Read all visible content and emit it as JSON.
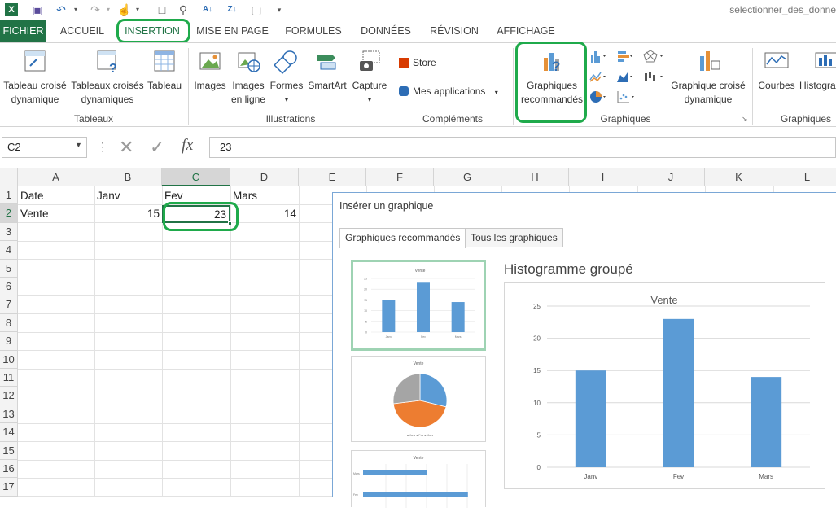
{
  "window": {
    "file_name": "selectionner_des_donne"
  },
  "tabs": [
    "FICHIER",
    "ACCUEIL",
    "INSERTION",
    "MISE EN PAGE",
    "FORMULES",
    "DONNÉES",
    "RÉVISION",
    "AFFICHAGE"
  ],
  "ribbon": {
    "tableaux": {
      "group": "Tableaux",
      "btn1": "Tableau croisé\ndynamique",
      "btn2": "Tableaux croisés\ndynamiques",
      "btn3": "Tableau"
    },
    "illustrations": {
      "group": "Illustrations",
      "images": "Images",
      "images_line": "Images\nen ligne",
      "formes": "Formes",
      "smartart": "SmartArt",
      "capture": "Capture"
    },
    "complements": {
      "group": "Compléments",
      "store": "Store",
      "apps": "Mes applications"
    },
    "graphiques": {
      "group": "Graphiques",
      "recommended": "Graphiques\nrecommandés",
      "pivot_chart": "Graphique croisé\ndynamique"
    },
    "sparklines": {
      "group": "Graphiques",
      "courbes": "Courbes",
      "histog": "Histogra"
    }
  },
  "formula_bar": {
    "name_box": "C2",
    "value": "23"
  },
  "sheet": {
    "columns": [
      "A",
      "B",
      "C",
      "D",
      "E",
      "F",
      "G",
      "H",
      "I",
      "J",
      "K",
      "L"
    ],
    "rows": [
      "1",
      "2",
      "3",
      "4",
      "5",
      "6",
      "7",
      "8",
      "9",
      "10",
      "11",
      "12",
      "13",
      "14",
      "15",
      "16",
      "17"
    ],
    "A1": "Date",
    "B1": "Janv",
    "C1": "Fev",
    "D1": "Mars",
    "A2": "Vente",
    "B2": "15",
    "C2": "23",
    "D2": "14"
  },
  "dialog": {
    "title": "Insérer un graphique",
    "tab1": "Graphiques recommandés",
    "tab2": "Tous les graphiques",
    "preview_title": "Histogramme groupé"
  },
  "chart_data": {
    "type": "bar",
    "title": "Vente",
    "categories": [
      "Janv",
      "Fev",
      "Mars"
    ],
    "values": [
      15,
      23,
      14
    ],
    "ylim": [
      0,
      25
    ],
    "yticks": [
      "25",
      "20",
      "15",
      "10",
      "5",
      "0"
    ],
    "color": "#5b9bd5",
    "grid": true
  },
  "thumbnails": {
    "t1_title": "Vente",
    "t2_title": "Vente",
    "t3_title": "Vente",
    "pie_legend": "■ Janv ■ Fev ■ Mars",
    "t3_cat1": "Mars",
    "t3_cat2": "Fev"
  },
  "colors": {
    "accent": "#217346",
    "highlight": "#1faa4b",
    "bar": "#5b9bd5",
    "pie_orange": "#ed7d31",
    "pie_gray": "#a5a5a5"
  }
}
